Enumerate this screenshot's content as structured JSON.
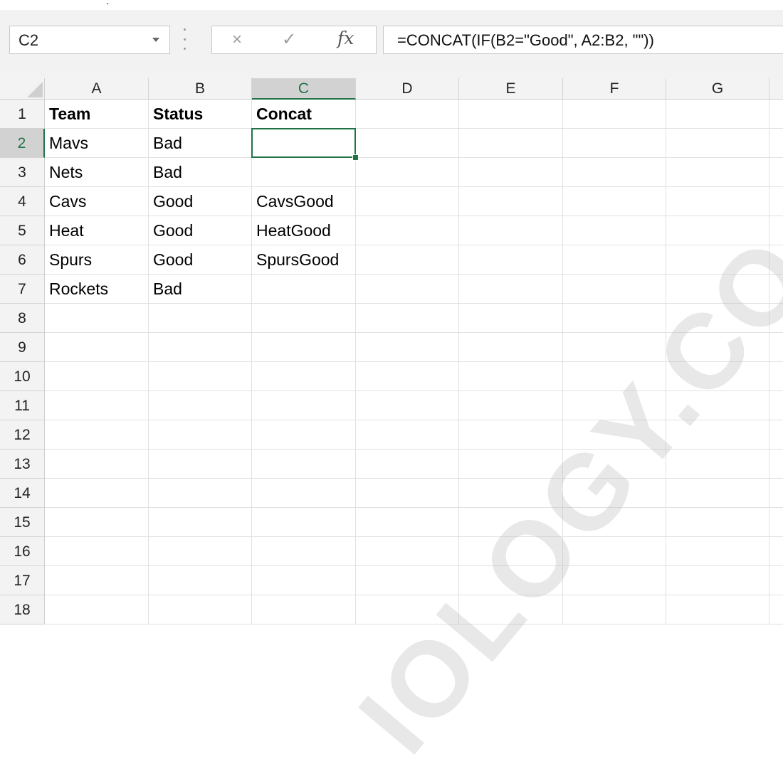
{
  "name_box": {
    "value": "C2"
  },
  "formula_bar": {
    "value": "=CONCAT(IF(B2=\"Good\", A2:B2, \"\"))"
  },
  "formula_icons": {
    "cancel": "×",
    "enter": "✓",
    "fx": "fx"
  },
  "columns": [
    "A",
    "B",
    "C",
    "D",
    "E",
    "F",
    "G"
  ],
  "active_column": "C",
  "active_row": 2,
  "rows": [
    1,
    2,
    3,
    4,
    5,
    6,
    7,
    8,
    9,
    10,
    11,
    12,
    13,
    14,
    15,
    16,
    17,
    18
  ],
  "cells": {
    "A1": "Team",
    "B1": "Status",
    "C1": "Concat",
    "A2": "Mavs",
    "B2": "Bad",
    "C2": "",
    "A3": "Nets",
    "B3": "Bad",
    "C3": "",
    "A4": "Cavs",
    "B4": "Good",
    "C4": "CavsGood",
    "A5": "Heat",
    "B5": "Good",
    "C5": "HeatGood",
    "A6": "Spurs",
    "B6": "Good",
    "C6": "SpursGood",
    "A7": "Rockets",
    "B7": "Bad",
    "C7": ""
  },
  "bold_rows": [
    1
  ],
  "watermark": {
    "text": "IOLOGY.CO"
  },
  "colors": {
    "selection": "#217346",
    "header_bg": "#f3f3f3",
    "gridline": "#e1e1e1"
  }
}
